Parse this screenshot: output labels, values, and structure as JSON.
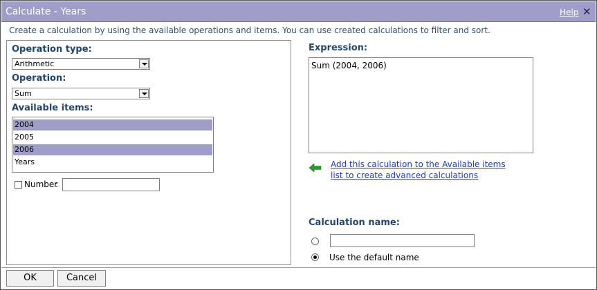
{
  "window": {
    "title": "Calculate -  Years",
    "help_label": "Help",
    "close_glyph": "✕"
  },
  "intro_text": "Create a calculation by using the available operations and items. You can use created calculations to filter and sort.",
  "operation_type": {
    "label": "Operation type:",
    "value": "Arithmetic"
  },
  "operation": {
    "label": "Operation:",
    "value": "Sum"
  },
  "available_items": {
    "label": "Available items:",
    "items": [
      {
        "label": "2004",
        "selected": true
      },
      {
        "label": "2005",
        "selected": false
      },
      {
        "label": "2006",
        "selected": true
      },
      {
        "label": "Years",
        "selected": false
      }
    ]
  },
  "number": {
    "label": "Number",
    "separator": ":",
    "checked": false,
    "value": ""
  },
  "expression": {
    "label": "Expression:",
    "value": "Sum (2004, 2006)"
  },
  "add_calc_link": {
    "line1": "Add this calculation to the Available items",
    "line2": "list to create advanced calculations",
    "icon": "green-left-arrow-icon"
  },
  "calculation_name": {
    "label": "Calculation name:",
    "custom_value": "",
    "default_option_label": "Use the default name",
    "selected_option": "default"
  },
  "footer": {
    "ok_label": "OK",
    "cancel_label": "Cancel"
  },
  "colors": {
    "titlebar": "#9e9ec8",
    "label_text": "#22466e",
    "link": "#1a3bd6",
    "selection": "#9e9ec8",
    "arrow_icon": "#2e9a2e"
  }
}
